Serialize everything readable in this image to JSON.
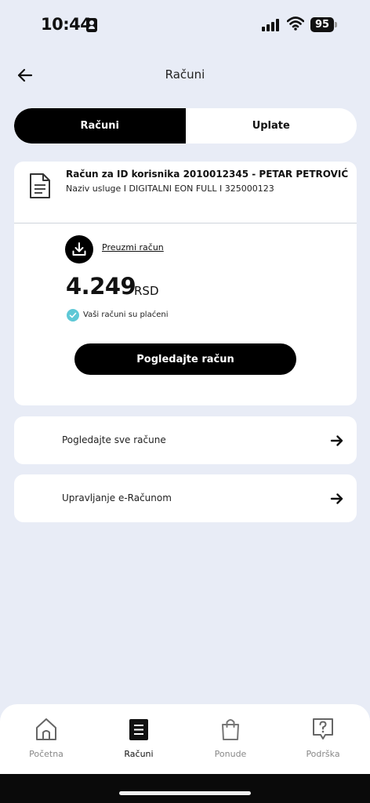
{
  "status_bar": {
    "time": "10:44",
    "battery": "95"
  },
  "header": {
    "title": "Računi"
  },
  "tabs": [
    {
      "label": "Računi",
      "active": true
    },
    {
      "label": "Uplate",
      "active": false
    }
  ],
  "bill": {
    "title": "Račun za ID korisnika 2010012345 - PETAR PETROVIĆ",
    "subtitle": "Naziv usluge I DIGITALNI EON FULL I 325000123",
    "download_label": "Preuzmi račun",
    "amount": "4.249",
    "currency": "RSD",
    "paid_status": "Vaši računi su plaćeni",
    "view_button": "Pogledajte račun"
  },
  "links": [
    {
      "label": "Pogledajte sve račune"
    },
    {
      "label": "Upravljanje e-Računom"
    }
  ],
  "bottom_nav": [
    {
      "label": "Početna",
      "icon": "home-icon",
      "active": false
    },
    {
      "label": "Računi",
      "icon": "bills-icon",
      "active": true
    },
    {
      "label": "Ponude",
      "icon": "shopping-bag-icon",
      "active": false
    },
    {
      "label": "Podrška",
      "icon": "support-icon",
      "active": false
    }
  ],
  "colors": {
    "background": "#e8ecf6",
    "accent": "#000000",
    "paid_check": "#5ec8d6"
  }
}
